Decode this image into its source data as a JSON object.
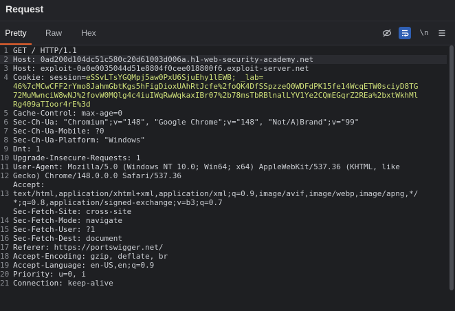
{
  "panel": {
    "title": "Request"
  },
  "tabs": [
    {
      "label": "Pretty"
    },
    {
      "label": "Raw"
    },
    {
      "label": "Hex"
    }
  ],
  "toolbar": {
    "hide_icon": "eye-slash-icon",
    "wrap_icon": "wrap-lines-icon",
    "newline_label": "\\n",
    "menu_icon": "menu-icon"
  },
  "editor": {
    "line_numbers": [
      "1",
      "2",
      "3",
      "4",
      "",
      "",
      "",
      "5",
      "6",
      "7",
      "8",
      "9",
      "10",
      "11",
      "12",
      "",
      "13",
      "",
      "",
      "14",
      "15",
      "16",
      "17",
      "18",
      "19",
      "20",
      "21"
    ],
    "lines": [
      {
        "k": "GET / HTTP/1.1",
        "v": ""
      },
      {
        "k": "Host: ",
        "v": "0ad200d104dc51c580c20d61003d006a.h1-web-security-academy.net"
      },
      {
        "k": "Host: ",
        "v": "exploit-0a0e0035044d51e8804f0cee018800f6.exploit-server.net"
      },
      {
        "k": "Cookie: session=",
        "v": "eSSvLTsYGQMpj5aw0PxU6SjuEhy1lEWB; _lab="
      },
      {
        "k": "",
        "v": "46%7cMCwCFF2rYmo8JahmGbtKgs5hFigDioxUAhRtJcfe%2foQK4DfSSpzzeQ0WDFdPK15fe14WcqETW0sciyD8TG"
      },
      {
        "k": "",
        "v": "72MuMwnciW8wNJ%2fovW0MQlg4c4iuIWqRwWqkaxIBr07%2b78msTbRBlnalLYV1Ye2CQmEGqrZ2REa%2bxtWkhMl"
      },
      {
        "k": "",
        "v": "Rg409aTIoor4rE%3d"
      },
      {
        "k": "Cache-Control: ",
        "v": "max-age=0"
      },
      {
        "k": "Sec-Ch-Ua: ",
        "v": "\"Chromium\";v=\"148\", \"Google Chrome\";v=\"148\", \"Not/A)Brand\";v=\"99\""
      },
      {
        "k": "Sec-Ch-Ua-Mobile: ",
        "v": "?0"
      },
      {
        "k": "Sec-Ch-Ua-Platform: ",
        "v": "\"Windows\""
      },
      {
        "k": "Dnt: ",
        "v": "1"
      },
      {
        "k": "Upgrade-Insecure-Requests: ",
        "v": "1"
      },
      {
        "k": "User-Agent: ",
        "v": "Mozilla/5.0 (Windows NT 10.0; Win64; x64) AppleWebKit/537.36 (KHTML, like"
      },
      {
        "k": "",
        "v": "Gecko) Chrome/148.0.0.0 Safari/537.36"
      },
      {
        "k": "Accept:",
        "v": ""
      },
      {
        "k": "",
        "v": "text/html,application/xhtml+xml,application/xml;q=0.9,image/avif,image/webp,image/apng,*/"
      },
      {
        "k": "",
        "v": "*;q=0.8,application/signed-exchange;v=b3;q=0.7"
      },
      {
        "k": "Sec-Fetch-Site: ",
        "v": "cross-site"
      },
      {
        "k": "Sec-Fetch-Mode: ",
        "v": "navigate"
      },
      {
        "k": "Sec-Fetch-User: ",
        "v": "?1"
      },
      {
        "k": "Sec-Fetch-Dest: ",
        "v": "document"
      },
      {
        "k": "Referer: ",
        "v": "https://portswigger.net/"
      },
      {
        "k": "Accept-Encoding: ",
        "v": "gzip, deflate, br"
      },
      {
        "k": "Accept-Language: ",
        "v": "en-US,en;q=0.9"
      },
      {
        "k": "Priority: ",
        "v": "u=0, i"
      },
      {
        "k": "Connection: ",
        "v": "keep-alive"
      }
    ]
  }
}
